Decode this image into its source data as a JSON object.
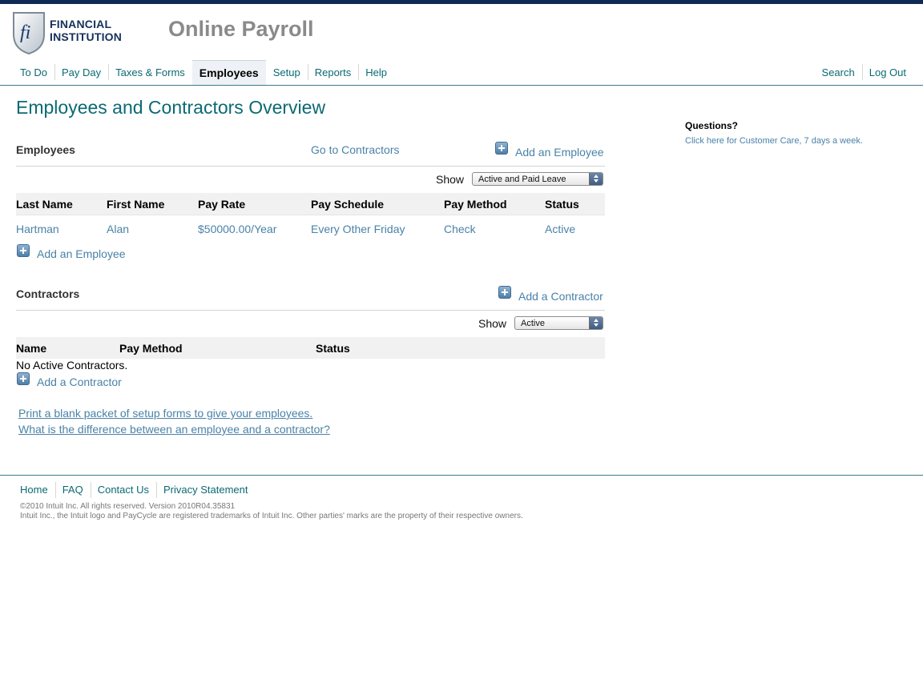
{
  "brand": {
    "logo_line1": "FINANCIAL",
    "logo_line2": "INSTITUTION",
    "app_title": "Online Payroll"
  },
  "nav": {
    "items": [
      {
        "label": "To Do"
      },
      {
        "label": "Pay Day"
      },
      {
        "label": "Taxes & Forms"
      },
      {
        "label": "Employees",
        "active": true
      },
      {
        "label": "Setup"
      },
      {
        "label": "Reports"
      },
      {
        "label": "Help"
      }
    ],
    "right": [
      {
        "label": "Search"
      },
      {
        "label": "Log Out"
      }
    ]
  },
  "page_title": "Employees and Contractors Overview",
  "employees": {
    "heading": "Employees",
    "go_to_contractors": "Go to Contractors",
    "add_label": "Add an Employee",
    "show_label": "Show",
    "show_value": "Active and Paid Leave",
    "columns": [
      "Last Name",
      "First Name",
      "Pay Rate",
      "Pay Schedule",
      "Pay Method",
      "Status"
    ],
    "rows": [
      [
        "Hartman",
        "Alan",
        "$50000.00/Year",
        "Every Other Friday",
        "Check",
        "Active"
      ]
    ]
  },
  "contractors": {
    "heading": "Contractors",
    "add_label": "Add a Contractor",
    "show_label": "Show",
    "show_value": "Active",
    "columns": [
      "Name",
      "Pay Method",
      "Status"
    ],
    "empty_text": "No Active Contractors."
  },
  "links": {
    "print_packet": "Print a blank packet of setup forms to give your employees.",
    "difference": "What is the difference between an employee and a contractor?"
  },
  "sidebar": {
    "questions": "Questions?",
    "customer_care": "Click here for Customer Care, 7 days a week."
  },
  "footer": {
    "items": [
      {
        "label": "Home"
      },
      {
        "label": "FAQ"
      },
      {
        "label": "Contact Us"
      },
      {
        "label": "Privacy Statement"
      }
    ],
    "copyright": "©2010 Intuit Inc. All rights reserved. Version 2010R04.35831",
    "trademark": "Intuit Inc., the Intuit logo and PayCycle are registered trademarks of Intuit Inc. Other parties' marks are the property of their respective owners."
  },
  "colors": {
    "brand_navy": "#0e2a55",
    "teal_link": "#0b6a73",
    "blue_link": "#4a82a8",
    "title_gray": "#8a8a8a"
  }
}
